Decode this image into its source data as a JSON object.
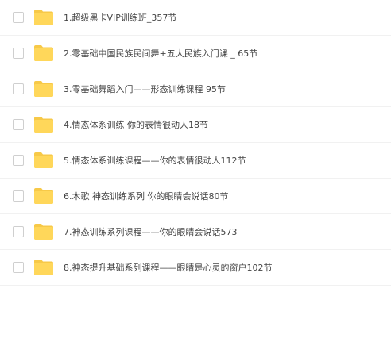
{
  "folder_color": "#FFD75A",
  "folder_tab_color": "#F7C948",
  "icon": "folder-icon",
  "files": [
    {
      "name": "1.超级黑卡VIP训练班_357节"
    },
    {
      "name": "2.零基础中国民族民间舞+五大民族入门课 _ 65节"
    },
    {
      "name": "3.零基础舞蹈入门——形态训练课程 95节"
    },
    {
      "name": "4.情态体系训练 你的表情很动人18节"
    },
    {
      "name": "5.情态体系训练课程——你的表情很动人112节"
    },
    {
      "name": "6.木歌 神态训练系列 你的眼睛会说话80节"
    },
    {
      "name": "7.神态训练系列课程——你的眼睛会说话573"
    },
    {
      "name": "8.神态提升基础系列课程——眼睛是心灵的窗户102节"
    }
  ]
}
